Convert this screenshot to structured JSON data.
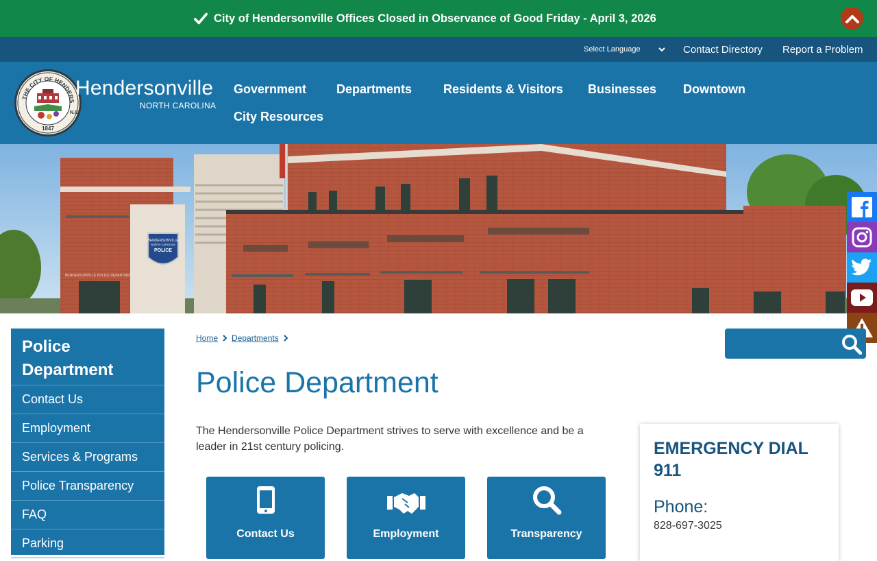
{
  "alert": {
    "text": "City of Hendersonville Offices Closed in Observance of Good Friday - April 3, 2026"
  },
  "utility": {
    "language_label": "Select Language",
    "contact_directory": "Contact Directory",
    "report_problem": "Report a Problem"
  },
  "header": {
    "seal_top": "THE CITY OF HENDERSONVILLE",
    "seal_right": "N.C.",
    "seal_year": "1847",
    "brand_name": "Hendersonville",
    "brand_sub": "NORTH CAROLINA",
    "nav": [
      "Government",
      "Departments",
      "Residents & Visitors",
      "Businesses",
      "Downtown",
      "City Resources"
    ]
  },
  "hero": {
    "sign_text_1": "HENDERSONVILLE",
    "sign_text_2": "NORTH CAROLINA",
    "sign_text_3": "POLICE",
    "wall_text": "HENDERSONVILLE POLICE DEPARTMENT"
  },
  "social": [
    "facebook-icon",
    "instagram-icon",
    "twitter-icon",
    "youtube-icon",
    "alert-icon"
  ],
  "colors": {
    "alert_green": "#12874a",
    "utility_blue": "#17547e",
    "brand_blue": "#1b74a8",
    "alert_toggle": "#b23a16"
  },
  "sidebar": {
    "title": "Police Department",
    "items": [
      "Contact Us",
      "Employment",
      "Services & Programs",
      "Police Transparency",
      "FAQ",
      "Parking"
    ]
  },
  "breadcrumb": [
    "Home",
    "Departments"
  ],
  "main": {
    "title": "Police Department",
    "intro": "The Hendersonville Police Department strives to serve with excellence and be a leader in 21st century policing.",
    "tiles": [
      {
        "label": "Contact Us",
        "icon": "mobile-phone-icon"
      },
      {
        "label": "Employment",
        "icon": "handshake-icon"
      },
      {
        "label": "Transparency",
        "icon": "magnifier-icon"
      }
    ]
  },
  "emergency": {
    "title": "EMERGENCY DIAL 911",
    "phone_label": "Phone:",
    "phone_value": "828-697-3025"
  }
}
